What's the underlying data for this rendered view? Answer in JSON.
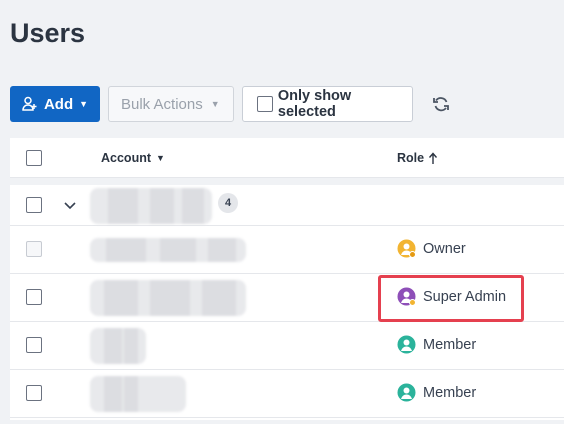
{
  "page": {
    "title": "Users"
  },
  "toolbar": {
    "add_label": "Add",
    "bulk_label": "Bulk Actions",
    "only_selected_label": "Only show selected"
  },
  "table": {
    "columns": {
      "account": "Account",
      "role": "Role"
    },
    "group": {
      "count": "4"
    },
    "rows": [
      {
        "role": "Owner",
        "avatar_color": "#f2b431",
        "disabled": true
      },
      {
        "role": "Super Admin",
        "avatar_color": "#8e4fb8",
        "highlighted": true
      },
      {
        "role": "Member",
        "avatar_color": "#2bb39b"
      },
      {
        "role": "Member",
        "avatar_color": "#2bb39b"
      }
    ]
  },
  "colors": {
    "primary": "#1166c4",
    "highlight": "#e5404f"
  },
  "icons": [
    "add-user-icon",
    "caret-down-icon",
    "refresh-icon",
    "sort-up-arrow-icon",
    "chevron-down-icon",
    "user-avatar-icon"
  ]
}
